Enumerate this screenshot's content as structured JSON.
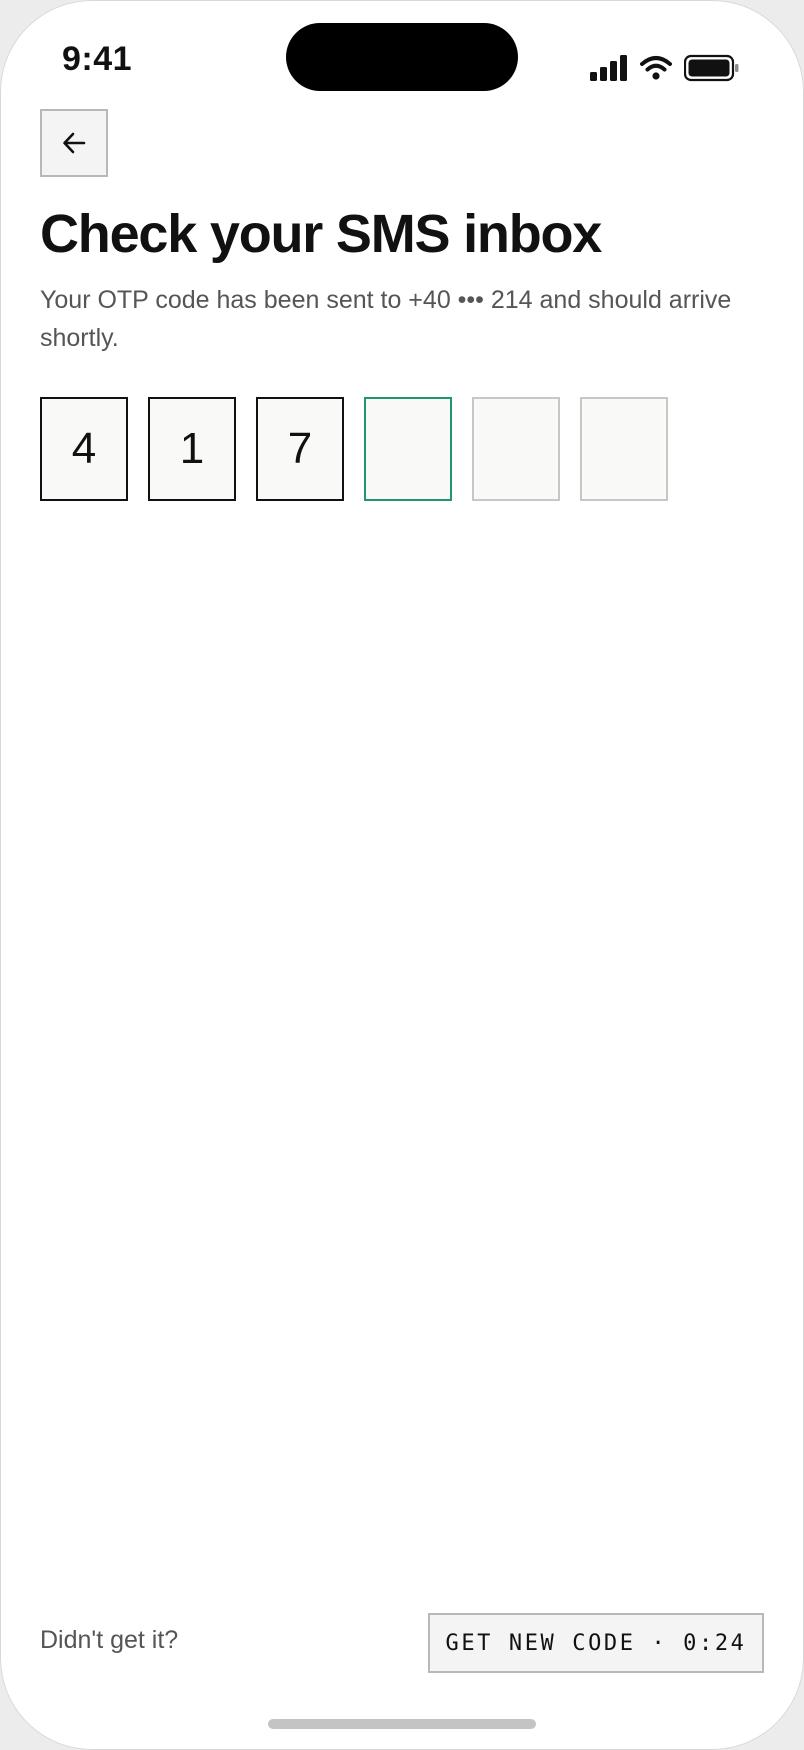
{
  "status_bar": {
    "time": "9:41",
    "icons": [
      "cellular-signal-icon",
      "wifi-icon",
      "battery-icon"
    ]
  },
  "header": {
    "back_icon": "arrow-left-icon"
  },
  "main": {
    "title": "Check your SMS inbox",
    "subtitle": "Your OTP code has been sent to +40 ••• 214 and should arrive shortly.",
    "otp": {
      "digits": [
        "4",
        "1",
        "7",
        "",
        "",
        ""
      ],
      "active_index": 3
    }
  },
  "footer": {
    "prompt": "Didn't get it?",
    "resend_label": "GET NEW CODE · 0:24"
  },
  "colors": {
    "accent": "#1e9670",
    "text_primary": "#111111",
    "text_secondary": "#555555",
    "box_border": "#c7c7c7",
    "box_background": "#f9f9f7"
  }
}
